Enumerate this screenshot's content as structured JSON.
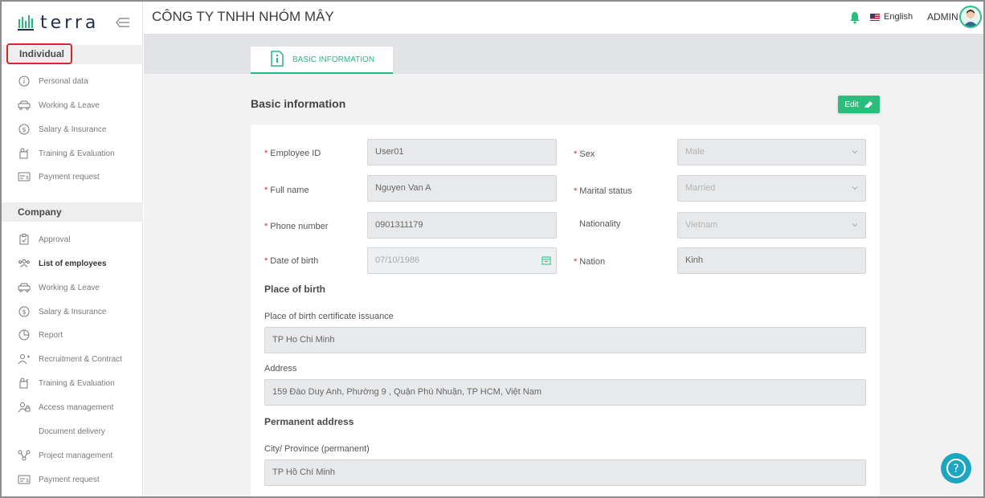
{
  "app": {
    "logo_text": "terra"
  },
  "header": {
    "company_name": "CÔNG TY TNHH NHÓM MÂY",
    "language": "English",
    "user": "ADMIN"
  },
  "sidebar": {
    "individual_heading": "Individual",
    "individual_items": [
      {
        "label": "Personal data",
        "icon": "info-icon"
      },
      {
        "label": "Working & Leave",
        "icon": "car-icon"
      },
      {
        "label": "Salary & Insurance",
        "icon": "dollar-icon"
      },
      {
        "label": "Training & Evaluation",
        "icon": "training-icon"
      },
      {
        "label": "Payment request",
        "icon": "card-icon"
      }
    ],
    "company_heading": "Company",
    "company_items": [
      {
        "label": "Approval",
        "icon": "clipboard-check-icon"
      },
      {
        "label": "List of employees",
        "icon": "users-icon",
        "active": true
      },
      {
        "label": "Working & Leave",
        "icon": "car-icon"
      },
      {
        "label": "Salary & Insurance",
        "icon": "dollar-icon"
      },
      {
        "label": "Report",
        "icon": "pie-chart-icon"
      },
      {
        "label": "Recruitment & Contract",
        "icon": "user-plus-icon"
      },
      {
        "label": "Training & Evaluation",
        "icon": "training-icon"
      },
      {
        "label": "Access management",
        "icon": "user-lock-icon"
      },
      {
        "label": "Document delivery",
        "icon": ""
      },
      {
        "label": "Project management",
        "icon": "network-icon"
      },
      {
        "label": "Payment request",
        "icon": "card-icon"
      }
    ]
  },
  "tabs": [
    {
      "label": "BASIC INFORMATION",
      "active": true
    }
  ],
  "main": {
    "section_title": "Basic information",
    "edit_label": "Edit",
    "fields": {
      "employee_id": {
        "label": "Employee ID",
        "value": "User01",
        "required": true
      },
      "full_name": {
        "label": "Full name",
        "value": "Nguyen Van A",
        "required": true
      },
      "phone": {
        "label": "Phone number",
        "value": "0901311179",
        "required": true
      },
      "dob": {
        "label": "Date of birth",
        "value": "07/10/1986",
        "required": true
      },
      "sex": {
        "label": "Sex",
        "value": "Male",
        "required": true
      },
      "marital": {
        "label": "Marital status",
        "value": "Married",
        "required": true
      },
      "nationality": {
        "label": "Nationality",
        "value": "Vietnam",
        "required": false
      },
      "nation": {
        "label": "Nation",
        "value": "Kinh",
        "required": true
      }
    },
    "place_of_birth_heading": "Place of birth",
    "birth_cert": {
      "label": "Place of birth certificate issuance",
      "value": "TP Ho Chi Minh"
    },
    "address": {
      "label": "Address",
      "value": "159 Đào Duy Anh, Phường 9 , Quận Phú Nhuận, TP HCM, Việt Nam"
    },
    "permanent_heading": "Permanent address",
    "city_permanent": {
      "label": "City/ Province (permanent)",
      "value": "TP Hồ Chí Minh"
    }
  },
  "colors": {
    "accent": "#27b881",
    "required": "#e2242b",
    "help": "#1ea6c1"
  }
}
